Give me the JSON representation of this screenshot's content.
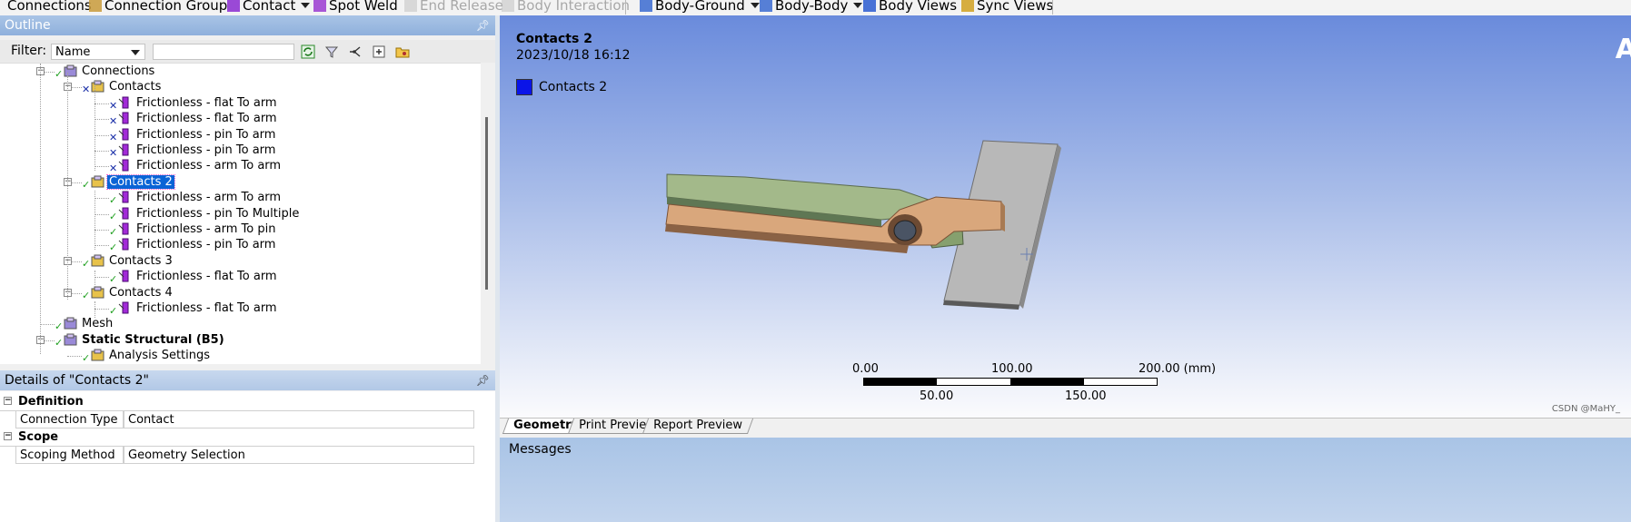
{
  "toolbar": {
    "items": [
      {
        "label": "Connections",
        "icon": "connections-icon",
        "disabled": false,
        "dropdown": false
      },
      {
        "label": "Connection Group",
        "icon": "connection-group-icon",
        "disabled": false,
        "dropdown": false
      },
      {
        "label": "Contact",
        "icon": "contact-icon",
        "disabled": false,
        "dropdown": true
      },
      {
        "label": "Spot Weld",
        "icon": "spot-weld-icon",
        "disabled": false,
        "dropdown": false
      },
      {
        "label": "End Release",
        "icon": "end-release-icon",
        "disabled": true,
        "dropdown": false
      },
      {
        "label": "Body Interaction",
        "icon": "body-interaction-icon",
        "disabled": true,
        "dropdown": false
      },
      {
        "label": "Body-Ground",
        "icon": "body-ground-icon",
        "disabled": false,
        "dropdown": true
      },
      {
        "label": "Body-Body",
        "icon": "body-body-icon",
        "disabled": false,
        "dropdown": true
      },
      {
        "label": "Body Views",
        "icon": "body-views-icon",
        "disabled": false,
        "dropdown": false
      },
      {
        "label": "Sync Views",
        "icon": "sync-views-icon",
        "disabled": false,
        "dropdown": false
      }
    ]
  },
  "outline": {
    "title": "Outline",
    "filter_label": "Filter:",
    "filter_value": "Name",
    "tree": [
      {
        "label": "Connections",
        "level": 2,
        "status": "ok",
        "expander": "−",
        "bold": false,
        "selected": false
      },
      {
        "label": "Contacts",
        "level": 3,
        "status": "x",
        "expander": "−",
        "bold": false,
        "selected": false
      },
      {
        "label": "Frictionless - flat To arm",
        "level": 4,
        "status": "x",
        "bold": false,
        "selected": false
      },
      {
        "label": "Frictionless - flat To arm",
        "level": 4,
        "status": "x",
        "bold": false,
        "selected": false
      },
      {
        "label": "Frictionless - pin To arm",
        "level": 4,
        "status": "x",
        "bold": false,
        "selected": false
      },
      {
        "label": "Frictionless - pin To arm",
        "level": 4,
        "status": "x",
        "bold": false,
        "selected": false
      },
      {
        "label": "Frictionless - arm To arm",
        "level": 4,
        "status": "x",
        "bold": false,
        "selected": false
      },
      {
        "label": "Contacts 2",
        "level": 3,
        "status": "ok",
        "expander": "−",
        "bold": false,
        "selected": true
      },
      {
        "label": "Frictionless - arm To arm",
        "level": 4,
        "status": "ok",
        "bold": false,
        "selected": false
      },
      {
        "label": "Frictionless - pin To Multiple",
        "level": 4,
        "status": "ok",
        "bold": false,
        "selected": false
      },
      {
        "label": "Frictionless - arm To pin",
        "level": 4,
        "status": "ok",
        "bold": false,
        "selected": false
      },
      {
        "label": "Frictionless - pin To arm",
        "level": 4,
        "status": "ok",
        "bold": false,
        "selected": false
      },
      {
        "label": "Contacts 3",
        "level": 3,
        "status": "ok",
        "expander": "−",
        "bold": false,
        "selected": false
      },
      {
        "label": "Frictionless - flat To arm",
        "level": 4,
        "status": "ok",
        "bold": false,
        "selected": false
      },
      {
        "label": "Contacts 4",
        "level": 3,
        "status": "ok",
        "expander": "−",
        "bold": false,
        "selected": false
      },
      {
        "label": "Frictionless - flat To arm",
        "level": 4,
        "status": "ok",
        "bold": false,
        "selected": false
      },
      {
        "label": "Mesh",
        "level": 2,
        "status": "ok",
        "bold": false,
        "selected": false
      },
      {
        "label": "Static Structural (B5)",
        "level": 2,
        "status": "ok",
        "expander": "−",
        "bold": true,
        "selected": false
      },
      {
        "label": "Analysis Settings",
        "level": 3,
        "status": "ok",
        "bold": false,
        "selected": false
      }
    ]
  },
  "details": {
    "title": "Details of \"Contacts 2\"",
    "rows": [
      {
        "type": "section",
        "label": "Definition"
      },
      {
        "type": "field",
        "label": "Connection Type",
        "value": "Contact"
      },
      {
        "type": "section",
        "label": "Scope"
      },
      {
        "type": "field",
        "label": "Scoping Method",
        "value": "Geometry Selection"
      }
    ]
  },
  "viewport": {
    "title": "Contacts 2",
    "date": "2023/10/18 16:12",
    "legend_label": "Contacts 2",
    "legend_color": "#0a14e8",
    "logo_text": "A",
    "scale": {
      "top_labels": [
        "0.00",
        "100.00",
        "200.00 (mm)"
      ],
      "bottom_labels": [
        "50.00",
        "150.00"
      ]
    },
    "watermark": "CSDN @MaHY_"
  },
  "tabs": [
    "Geometry",
    "Print Preview",
    "Report Preview"
  ],
  "messages_label": "Messages"
}
